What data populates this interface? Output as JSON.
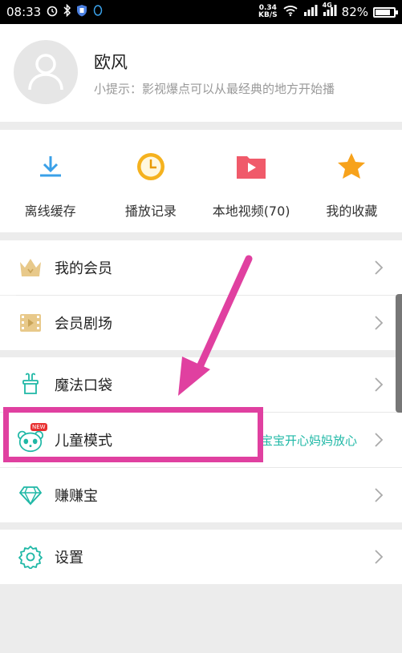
{
  "status": {
    "time": "08:33",
    "net_speed_value": "0.34",
    "net_speed_unit": "KB/S",
    "network": "4G",
    "battery_pct": "82%",
    "battery_level": 0.82
  },
  "profile": {
    "name": "欧风",
    "tip": "小提示：影视爆点可以从最经典的地方开始播"
  },
  "quick_actions": [
    {
      "label": "离线缓存",
      "icon": "download-icon"
    },
    {
      "label": "播放记录",
      "icon": "clock-icon"
    },
    {
      "label": "本地视频(70)",
      "icon": "folder-play-icon"
    },
    {
      "label": "我的收藏",
      "icon": "star-icon"
    }
  ],
  "menu": {
    "vip": "我的会员",
    "theater": "会员剧场",
    "magic": "魔法口袋",
    "kids": "儿童模式",
    "kids_badge": "NEW",
    "kids_sub": "宝宝开心妈妈放心",
    "earn": "赚赚宝",
    "settings": "设置"
  },
  "colors": {
    "accent_teal": "#1fb8a6",
    "highlight_pink": "#e040a0",
    "download_blue": "#3aa0e8",
    "clock_orange": "#f5b21e",
    "folder_red": "#f05a6a",
    "star_orange": "#f7a21b"
  }
}
